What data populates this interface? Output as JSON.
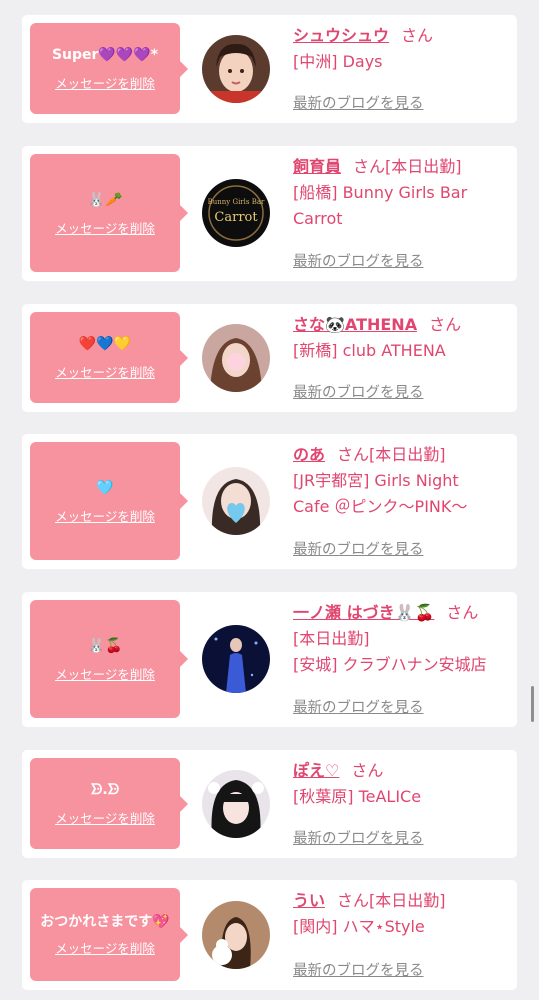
{
  "delete_label": "メッセージを削除",
  "blog_label": "最新のブログを見る",
  "san_label": "さん",
  "cards": [
    {
      "message": "Super💜💜💜*",
      "name": "シュウシュウ",
      "suffix": "さん",
      "lines": [
        "[中洲] Days"
      ]
    },
    {
      "message": "🐰🥕",
      "name": "飼育員",
      "suffix": "さん[本日出勤]",
      "lines": [
        "[船橋] Bunny Girls Bar",
        "Carrot"
      ],
      "logo_small": "Bunny Girls Bar",
      "logo_big": "Carrot"
    },
    {
      "message": "❤️💙💛",
      "name": "さな🐼ATHENA",
      "suffix": "さん",
      "lines": [
        "[新橋] club ATHENA"
      ]
    },
    {
      "message": "🩵",
      "name": "のあ",
      "suffix": "さん[本日出勤]",
      "lines": [
        "[JR宇都宮] Girls Night",
        "Cafe ＠ピンク〜PINK〜"
      ]
    },
    {
      "message": "🐰🍒",
      "name": "一ノ瀬 はづき🐰🍒",
      "suffix": "さん",
      "lines": [
        "[本日出勤]",
        "[安城] クラブハナン安城店"
      ]
    },
    {
      "message": "ᗦ.ᗦ",
      "name": "ぽえ♡",
      "suffix": "さん",
      "lines": [
        "[秋葉原] TeALICe"
      ]
    },
    {
      "message": "おつかれさまです💖",
      "name": "うい",
      "suffix": "さん[本日出勤]",
      "lines": [
        "[関内] ハマ⋆Style"
      ]
    }
  ],
  "colors": {
    "accent": "#e0466f",
    "bubble": "#f7929f",
    "background": "#efeff2"
  }
}
